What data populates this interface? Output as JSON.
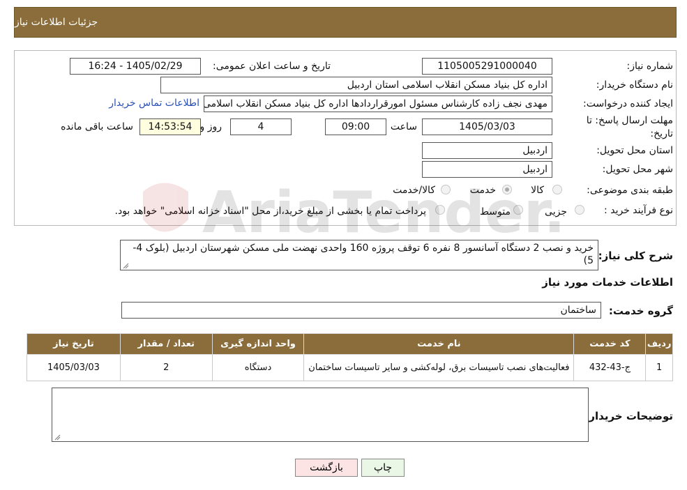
{
  "header": {
    "title": "جزئیات اطلاعات نیاز"
  },
  "form": {
    "need_number_label": "شماره نیاز:",
    "need_number": "1105005291000040",
    "announce_label": "تاریخ و ساعت اعلان عمومی:",
    "announce_value": "1405/02/29 - 16:24",
    "buyer_org_label": "نام دستگاه خریدار:",
    "buyer_org": "اداره کل بنیاد مسکن انقلاب اسلامی استان اردبیل",
    "creator_label": "ایجاد کننده درخواست:",
    "creator": "مهدی نجف زاده کارشناس مسئول امورقراردادها اداره کل بنیاد مسکن انقلاب اسلامی استان اردبیل",
    "contact_link": "اطلاعات تماس خریدار",
    "deadline_label": "مهلت ارسال پاسخ: تا تاریخ:",
    "deadline_date": "1405/03/03",
    "time_label": "ساعت",
    "deadline_time": "09:00",
    "days_value": "4",
    "days_label": "روز و",
    "remaining_time": "14:53:54",
    "remaining_label": "ساعت باقی مانده",
    "province_label": "استان محل تحویل:",
    "province": "اردبیل",
    "city_label": "شهر محل تحویل:",
    "city": "اردبیل",
    "category_label": "طبقه بندی موضوعی:",
    "category_options": [
      "کالا",
      "خدمت",
      "کالا/خدمت"
    ],
    "category_selected": "خدمت",
    "process_label": "نوع فرآیند خرید :",
    "process_options": [
      "جزیی",
      "متوسط"
    ],
    "process_note": "پرداخت تمام یا بخشی از مبلغ خرید،از محل \"اسناد خزانه اسلامی\" خواهد بود."
  },
  "summary": {
    "label": "شرح کلی نیاز:",
    "text": "خرید و نصب 2 دستگاه آسانسور 8 نفره 6 توقف پروژه 160 واحدی نهضت ملی مسکن شهرستان اردبیل (بلوک 4-5)"
  },
  "services": {
    "section_title": "اطلاعات خدمات مورد نیاز",
    "group_label": "گروه خدمت:",
    "group_value": "ساختمان",
    "columns": [
      "ردیف",
      "کد خدمت",
      "نام خدمت",
      "واحد اندازه گیری",
      "تعداد / مقدار",
      "تاریخ نیاز"
    ],
    "rows": [
      [
        "1",
        "ج-43-432",
        "فعالیت‌های نصب تاسیسات برق، لوله‌کشی و سایر تاسیسات ساختمان",
        "دستگاه",
        "2",
        "1405/03/03"
      ]
    ]
  },
  "buyer_notes": {
    "label": "توضیحات خریدار:",
    "text": ""
  },
  "buttons": {
    "print": "چاپ",
    "back": "بازگشت"
  },
  "watermark": {
    "text": "AriaTender.neT"
  },
  "colors": {
    "header_bg": "#8a6d3b",
    "link": "#2a4fb5",
    "back_button_bg": "#fce4e4",
    "print_button_bg": "#eaf6e6"
  }
}
